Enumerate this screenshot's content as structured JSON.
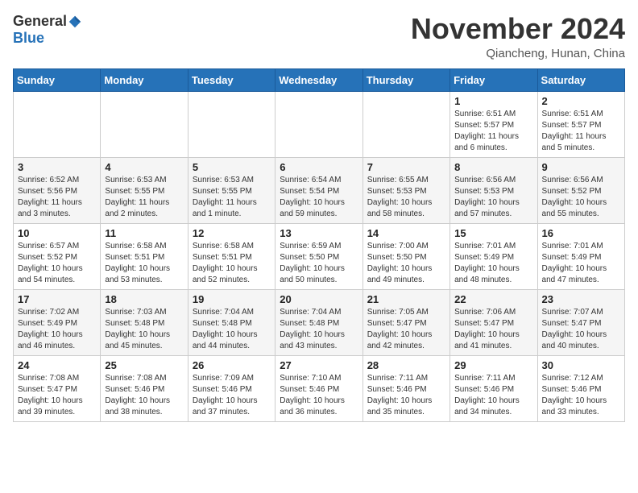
{
  "logo": {
    "general": "General",
    "blue": "Blue"
  },
  "header": {
    "month": "November 2024",
    "location": "Qiancheng, Hunan, China"
  },
  "weekdays": [
    "Sunday",
    "Monday",
    "Tuesday",
    "Wednesday",
    "Thursday",
    "Friday",
    "Saturday"
  ],
  "weeks": [
    [
      {
        "day": "",
        "info": ""
      },
      {
        "day": "",
        "info": ""
      },
      {
        "day": "",
        "info": ""
      },
      {
        "day": "",
        "info": ""
      },
      {
        "day": "",
        "info": ""
      },
      {
        "day": "1",
        "info": "Sunrise: 6:51 AM\nSunset: 5:57 PM\nDaylight: 11 hours\nand 6 minutes."
      },
      {
        "day": "2",
        "info": "Sunrise: 6:51 AM\nSunset: 5:57 PM\nDaylight: 11 hours\nand 5 minutes."
      }
    ],
    [
      {
        "day": "3",
        "info": "Sunrise: 6:52 AM\nSunset: 5:56 PM\nDaylight: 11 hours\nand 3 minutes."
      },
      {
        "day": "4",
        "info": "Sunrise: 6:53 AM\nSunset: 5:55 PM\nDaylight: 11 hours\nand 2 minutes."
      },
      {
        "day": "5",
        "info": "Sunrise: 6:53 AM\nSunset: 5:55 PM\nDaylight: 11 hours\nand 1 minute."
      },
      {
        "day": "6",
        "info": "Sunrise: 6:54 AM\nSunset: 5:54 PM\nDaylight: 10 hours\nand 59 minutes."
      },
      {
        "day": "7",
        "info": "Sunrise: 6:55 AM\nSunset: 5:53 PM\nDaylight: 10 hours\nand 58 minutes."
      },
      {
        "day": "8",
        "info": "Sunrise: 6:56 AM\nSunset: 5:53 PM\nDaylight: 10 hours\nand 57 minutes."
      },
      {
        "day": "9",
        "info": "Sunrise: 6:56 AM\nSunset: 5:52 PM\nDaylight: 10 hours\nand 55 minutes."
      }
    ],
    [
      {
        "day": "10",
        "info": "Sunrise: 6:57 AM\nSunset: 5:52 PM\nDaylight: 10 hours\nand 54 minutes."
      },
      {
        "day": "11",
        "info": "Sunrise: 6:58 AM\nSunset: 5:51 PM\nDaylight: 10 hours\nand 53 minutes."
      },
      {
        "day": "12",
        "info": "Sunrise: 6:58 AM\nSunset: 5:51 PM\nDaylight: 10 hours\nand 52 minutes."
      },
      {
        "day": "13",
        "info": "Sunrise: 6:59 AM\nSunset: 5:50 PM\nDaylight: 10 hours\nand 50 minutes."
      },
      {
        "day": "14",
        "info": "Sunrise: 7:00 AM\nSunset: 5:50 PM\nDaylight: 10 hours\nand 49 minutes."
      },
      {
        "day": "15",
        "info": "Sunrise: 7:01 AM\nSunset: 5:49 PM\nDaylight: 10 hours\nand 48 minutes."
      },
      {
        "day": "16",
        "info": "Sunrise: 7:01 AM\nSunset: 5:49 PM\nDaylight: 10 hours\nand 47 minutes."
      }
    ],
    [
      {
        "day": "17",
        "info": "Sunrise: 7:02 AM\nSunset: 5:49 PM\nDaylight: 10 hours\nand 46 minutes."
      },
      {
        "day": "18",
        "info": "Sunrise: 7:03 AM\nSunset: 5:48 PM\nDaylight: 10 hours\nand 45 minutes."
      },
      {
        "day": "19",
        "info": "Sunrise: 7:04 AM\nSunset: 5:48 PM\nDaylight: 10 hours\nand 44 minutes."
      },
      {
        "day": "20",
        "info": "Sunrise: 7:04 AM\nSunset: 5:48 PM\nDaylight: 10 hours\nand 43 minutes."
      },
      {
        "day": "21",
        "info": "Sunrise: 7:05 AM\nSunset: 5:47 PM\nDaylight: 10 hours\nand 42 minutes."
      },
      {
        "day": "22",
        "info": "Sunrise: 7:06 AM\nSunset: 5:47 PM\nDaylight: 10 hours\nand 41 minutes."
      },
      {
        "day": "23",
        "info": "Sunrise: 7:07 AM\nSunset: 5:47 PM\nDaylight: 10 hours\nand 40 minutes."
      }
    ],
    [
      {
        "day": "24",
        "info": "Sunrise: 7:08 AM\nSunset: 5:47 PM\nDaylight: 10 hours\nand 39 minutes."
      },
      {
        "day": "25",
        "info": "Sunrise: 7:08 AM\nSunset: 5:46 PM\nDaylight: 10 hours\nand 38 minutes."
      },
      {
        "day": "26",
        "info": "Sunrise: 7:09 AM\nSunset: 5:46 PM\nDaylight: 10 hours\nand 37 minutes."
      },
      {
        "day": "27",
        "info": "Sunrise: 7:10 AM\nSunset: 5:46 PM\nDaylight: 10 hours\nand 36 minutes."
      },
      {
        "day": "28",
        "info": "Sunrise: 7:11 AM\nSunset: 5:46 PM\nDaylight: 10 hours\nand 35 minutes."
      },
      {
        "day": "29",
        "info": "Sunrise: 7:11 AM\nSunset: 5:46 PM\nDaylight: 10 hours\nand 34 minutes."
      },
      {
        "day": "30",
        "info": "Sunrise: 7:12 AM\nSunset: 5:46 PM\nDaylight: 10 hours\nand 33 minutes."
      }
    ]
  ]
}
